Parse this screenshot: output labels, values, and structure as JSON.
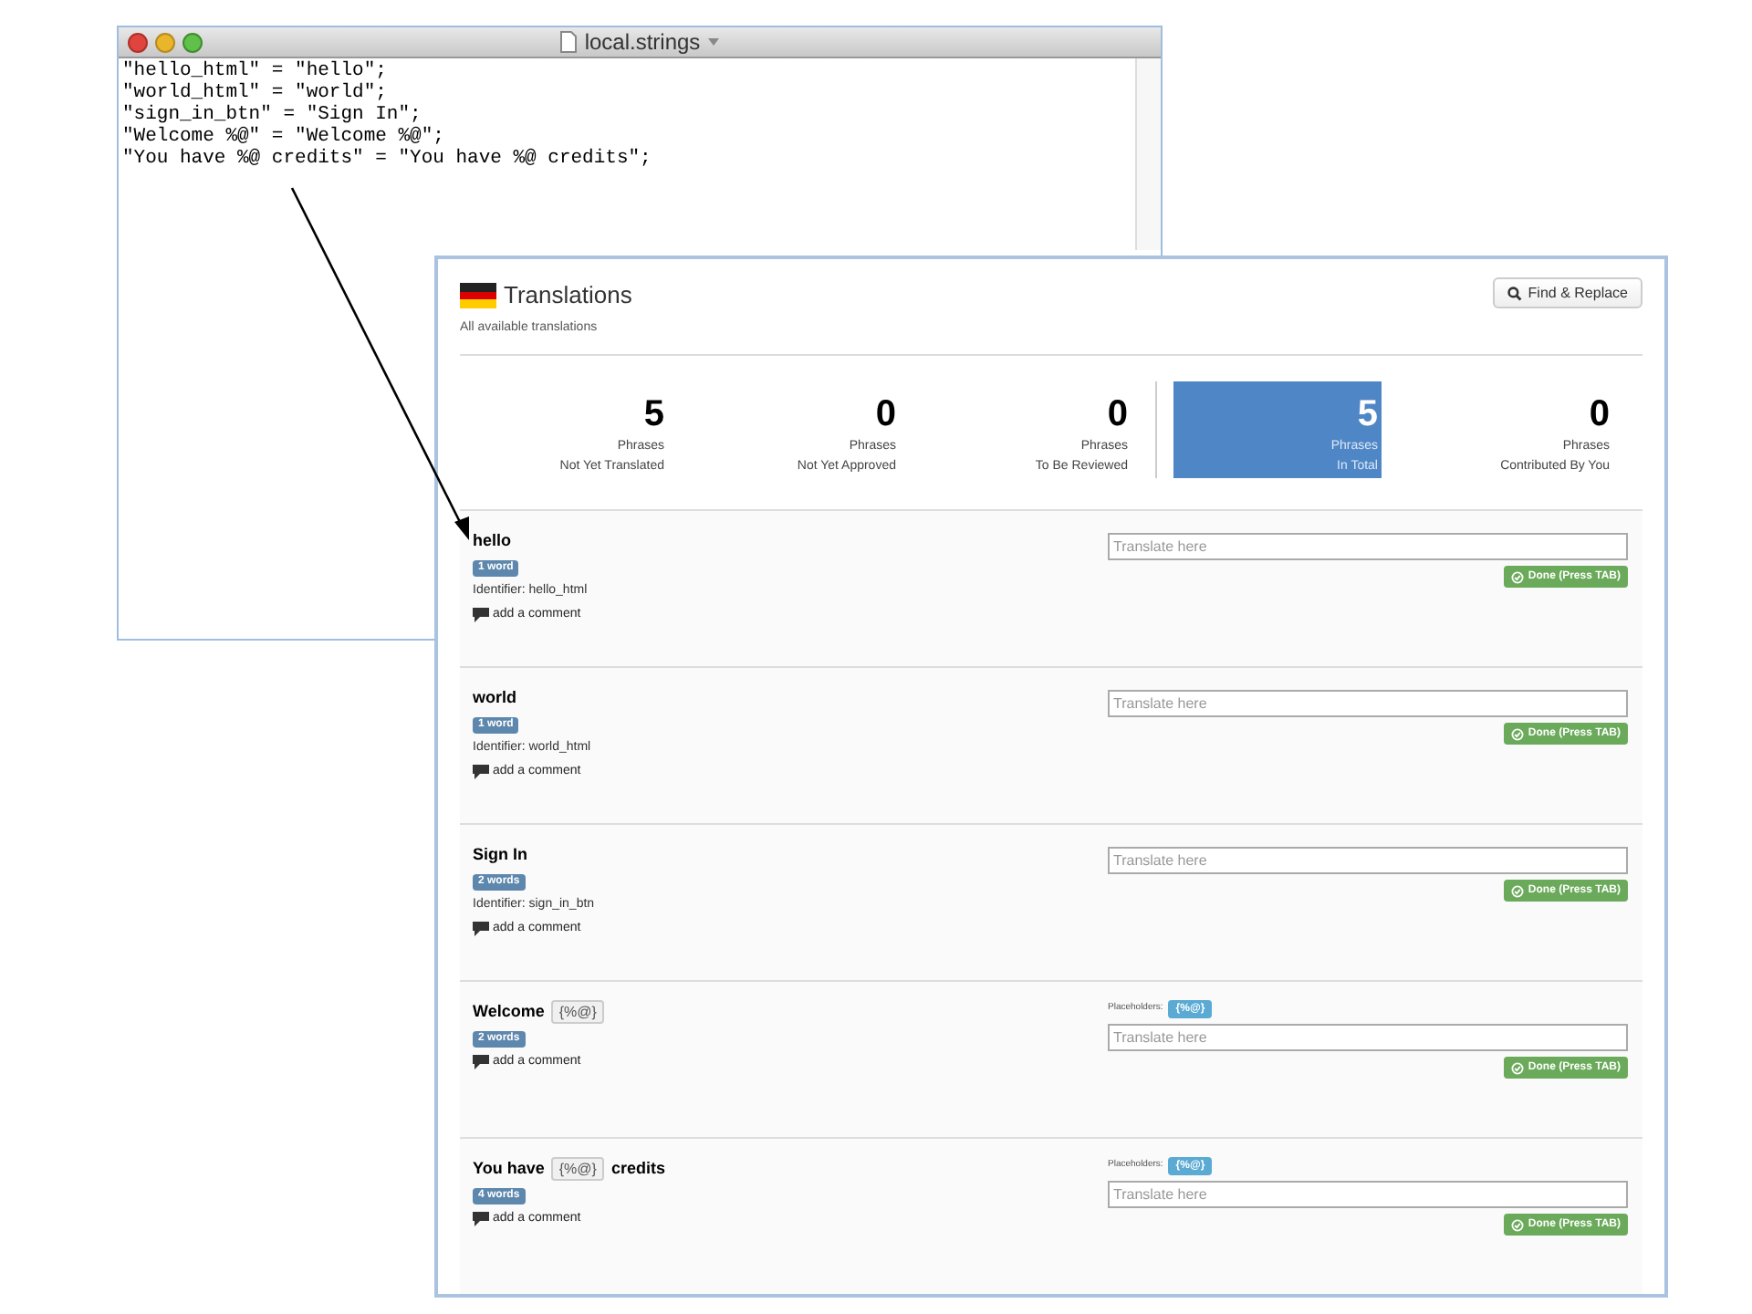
{
  "editor": {
    "title": "local.strings",
    "lines": [
      "\"hello_html\" = \"hello\";",
      "\"world_html\" = \"world\";",
      "\"sign_in_btn\" = \"Sign In\";",
      "\"Welcome %@\" = \"Welcome %@\";",
      "\"You have %@ credits\" = \"You have %@ credits\";"
    ]
  },
  "translations": {
    "title": "Translations",
    "subtitle": "All available translations",
    "find_button": "Find & Replace",
    "stats": [
      {
        "number": "5",
        "label": "Phrases",
        "caption": "Not Yet Translated",
        "selected": false
      },
      {
        "number": "0",
        "label": "Phrases",
        "caption": "Not Yet Approved",
        "selected": false
      },
      {
        "number": "0",
        "label": "Phrases",
        "caption": "To Be Reviewed",
        "selected": false
      },
      {
        "number": "5",
        "label": "Phrases",
        "caption": "In Total",
        "selected": true
      },
      {
        "number": "0",
        "label": "Phrases",
        "caption": "Contributed By You",
        "selected": false
      }
    ],
    "phrases": [
      {
        "title": [
          {
            "kind": "text",
            "text": "hello"
          }
        ],
        "count": "1 word",
        "identifier_label": "Identifier:",
        "identifier": "hello_html",
        "comment": "add a comment",
        "input_placeholder": "Translate here",
        "done": "Done (Press TAB)"
      },
      {
        "title": [
          {
            "kind": "text",
            "text": "world"
          }
        ],
        "count": "1 word",
        "identifier_label": "Identifier:",
        "identifier": "world_html",
        "comment": "add a comment",
        "input_placeholder": "Translate here",
        "done": "Done (Press TAB)"
      },
      {
        "title": [
          {
            "kind": "text",
            "text": "Sign In"
          }
        ],
        "count": "2 words",
        "identifier_label": "Identifier:",
        "identifier": "sign_in_btn",
        "comment": "add a comment",
        "input_placeholder": "Translate here",
        "done": "Done (Press TAB)"
      },
      {
        "title": [
          {
            "kind": "text",
            "text": "Welcome"
          },
          {
            "kind": "token",
            "text": "{%@}"
          }
        ],
        "count": "2 words",
        "comment": "add a comment",
        "placeholders_label": "Placeholders:",
        "placeholders": [
          "{%@}"
        ],
        "input_placeholder": "Translate here",
        "done": "Done (Press TAB)"
      },
      {
        "title": [
          {
            "kind": "text",
            "text": "You have"
          },
          {
            "kind": "token",
            "text": "{%@}"
          },
          {
            "kind": "text",
            "text": "credits"
          }
        ],
        "count": "4 words",
        "comment": "add a comment",
        "placeholders_label": "Placeholders:",
        "placeholders": [
          "{%@}"
        ],
        "input_placeholder": "Translate here",
        "done": "Done (Press TAB)"
      }
    ]
  }
}
